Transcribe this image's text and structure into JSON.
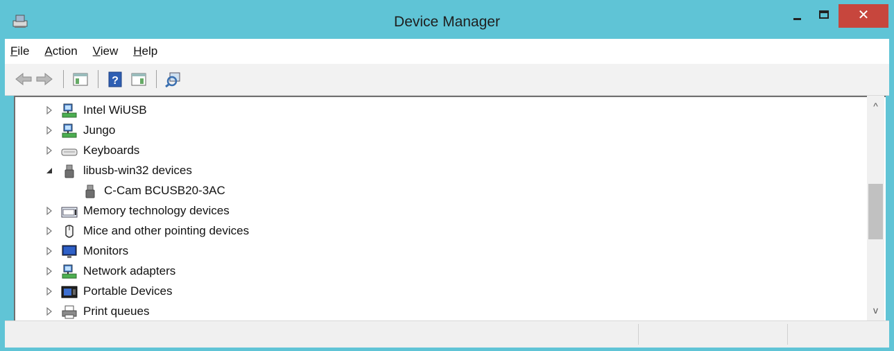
{
  "window": {
    "title": "Device Manager",
    "close_glyph": "✕"
  },
  "menu": [
    {
      "label_u": "F",
      "label_rest": "ile"
    },
    {
      "label_u": "A",
      "label_rest": "ction"
    },
    {
      "label_u": "V",
      "label_rest": "iew"
    },
    {
      "label_u": "H",
      "label_rest": "elp"
    }
  ],
  "toolbar": {
    "icons": [
      "back-arrow-icon",
      "forward-arrow-icon",
      "show-hide-console-tree-icon",
      "help-icon",
      "action-pane-icon",
      "scan-hardware-changes-icon"
    ]
  },
  "tree": {
    "rows": [
      {
        "label": "Intel WiUSB",
        "state": "collapsed",
        "icon": "network-adapter-icon",
        "level": 0
      },
      {
        "label": "Jungo",
        "state": "collapsed",
        "icon": "network-adapter-icon",
        "level": 0
      },
      {
        "label": "Keyboards",
        "state": "collapsed",
        "icon": "keyboard-icon",
        "level": 0
      },
      {
        "label": "libusb-win32 devices",
        "state": "expanded",
        "icon": "usb-plug-icon",
        "level": 0
      },
      {
        "label": "C-Cam BCUSB20-3AC",
        "state": "leaf",
        "icon": "usb-plug-icon",
        "level": 1
      },
      {
        "label": "Memory technology devices",
        "state": "collapsed",
        "icon": "memory-device-icon",
        "level": 0
      },
      {
        "label": "Mice and other pointing devices",
        "state": "collapsed",
        "icon": "mouse-icon",
        "level": 0
      },
      {
        "label": "Monitors",
        "state": "collapsed",
        "icon": "monitor-icon",
        "level": 0
      },
      {
        "label": "Network adapters",
        "state": "collapsed",
        "icon": "network-adapter-icon",
        "level": 0
      },
      {
        "label": "Portable Devices",
        "state": "collapsed",
        "icon": "portable-device-icon",
        "level": 0
      },
      {
        "label": "Print queues",
        "state": "collapsed",
        "icon": "printer-icon",
        "level": 0
      }
    ]
  },
  "scrollbar": {
    "up_glyph": "^",
    "down_glyph": "v",
    "position_fraction": 0.45
  },
  "colors": {
    "titlebar": "#5fc4d6",
    "close": "#c7463d"
  }
}
